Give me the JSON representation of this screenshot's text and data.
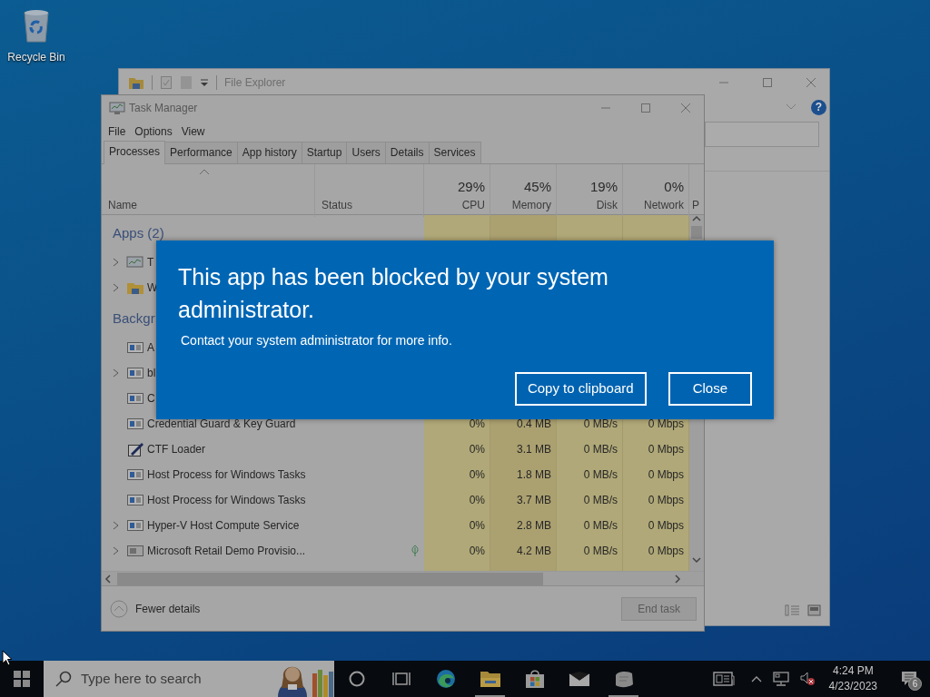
{
  "desktop_icons": [
    {
      "label": "Recycle Bin"
    }
  ],
  "file_explorer": {
    "title": "File Explorer",
    "help": "?"
  },
  "task_manager": {
    "title": "Task Manager",
    "menu": [
      "File",
      "Options",
      "View"
    ],
    "tabs": [
      {
        "label": "Processes",
        "selected": true
      },
      {
        "label": "Performance",
        "selected": false
      },
      {
        "label": "App history",
        "selected": false
      },
      {
        "label": "Startup",
        "selected": false
      },
      {
        "label": "Users",
        "selected": false
      },
      {
        "label": "Details",
        "selected": false
      },
      {
        "label": "Services",
        "selected": false
      }
    ],
    "columns": [
      {
        "kind": "name",
        "label": "Name",
        "sorted": true
      },
      {
        "kind": "text",
        "label": "Status"
      },
      {
        "kind": "metric",
        "percent": "29%",
        "label": "CPU"
      },
      {
        "kind": "metric",
        "percent": "45%",
        "label": "Memory"
      },
      {
        "kind": "metric",
        "percent": "19%",
        "label": "Disk"
      },
      {
        "kind": "metric",
        "percent": "0%",
        "label": "Network"
      },
      {
        "kind": "cut",
        "label": "P"
      }
    ],
    "rows": [
      {
        "kind": "group",
        "label": "Apps (2)"
      },
      {
        "kind": "monitor",
        "name": "T",
        "expandable": true,
        "selected": false,
        "leaf": false
      },
      {
        "kind": "folder",
        "name": "W",
        "expandable": true,
        "selected": false,
        "leaf": false
      },
      {
        "kind": "group",
        "label": "Backgr"
      },
      {
        "kind": "service",
        "name": "A",
        "expandable": false,
        "selected": false,
        "leaf": false
      },
      {
        "kind": "service",
        "name": "bl",
        "expandable": true,
        "selected": false,
        "leaf": false
      },
      {
        "kind": "service",
        "name": "C",
        "expandable": false,
        "selected": false,
        "leaf": false
      },
      {
        "kind": "service",
        "name": "Credential Guard & Key Guard",
        "expandable": false,
        "selected": false,
        "leaf": false,
        "cpu": "0%",
        "memory": "0.4 MB",
        "disk": "0 MB/s",
        "network": "0 Mbps"
      },
      {
        "kind": "pen",
        "name": "CTF Loader",
        "expandable": false,
        "selected": false,
        "leaf": false,
        "cpu": "0%",
        "memory": "3.1 MB",
        "disk": "0 MB/s",
        "network": "0 Mbps"
      },
      {
        "kind": "service",
        "name": "Host Process for Windows Tasks",
        "expandable": false,
        "selected": false,
        "leaf": false,
        "cpu": "0%",
        "memory": "1.8 MB",
        "disk": "0 MB/s",
        "network": "0 Mbps"
      },
      {
        "kind": "service",
        "name": "Host Process for Windows Tasks",
        "expandable": false,
        "selected": false,
        "leaf": false,
        "cpu": "0%",
        "memory": "3.7 MB",
        "disk": "0 MB/s",
        "network": "0 Mbps"
      },
      {
        "kind": "service",
        "name": "Hyper-V Host Compute Service",
        "expandable": true,
        "selected": false,
        "leaf": false,
        "cpu": "0%",
        "memory": "2.8 MB",
        "disk": "0 MB/s",
        "network": "0 Mbps"
      },
      {
        "kind": "retail",
        "name": "Microsoft Retail Demo Provisio...",
        "expandable": true,
        "selected": false,
        "leaf": true,
        "cpu": "0%",
        "memory": "4.2 MB",
        "disk": "0 MB/s",
        "network": "0 Mbps"
      }
    ],
    "fewer_details": "Fewer details",
    "end_task": {
      "label": "End task",
      "disabled": true
    }
  },
  "dialog": {
    "title": "This app has been blocked by your system administrator.",
    "message": "Contact your system administrator for more info.",
    "buttons": [
      "Copy to clipboard",
      "Close"
    ]
  },
  "taskbar": {
    "search_placeholder": "Type here to search",
    "apps": [
      {
        "kind": "cortana",
        "running": false
      },
      {
        "kind": "task-view",
        "running": false
      },
      {
        "kind": "edge",
        "running": false
      },
      {
        "kind": "file-explorer",
        "running": true
      },
      {
        "kind": "store",
        "running": false
      },
      {
        "kind": "mail",
        "running": false
      },
      {
        "kind": "app",
        "running": true
      }
    ],
    "time": "4:24 PM",
    "date": "4/23/2023",
    "notifications": "6"
  }
}
